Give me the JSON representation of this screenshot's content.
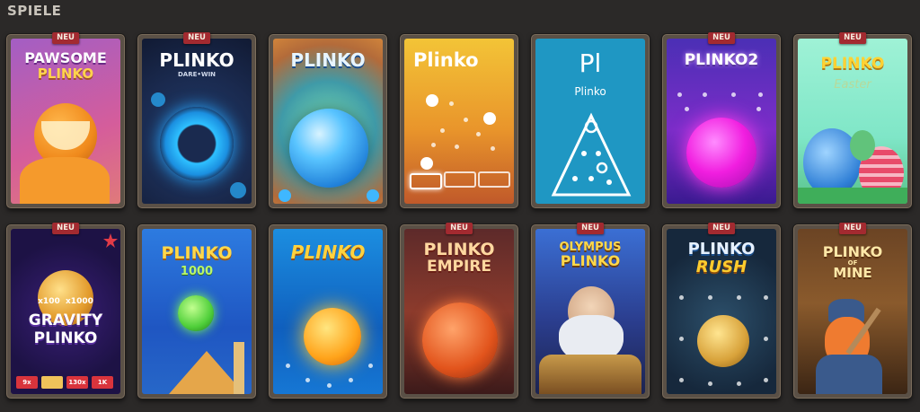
{
  "section": {
    "title": "SPIELE"
  },
  "badge_label": "NEU",
  "games": [
    {
      "logo": "PAWSOME",
      "logo2": "PLINKO",
      "badge": true
    },
    {
      "logo": "PLINKO",
      "sub": "DARE•WIN",
      "badge": true
    },
    {
      "logo": "PLINKO",
      "badge": false
    },
    {
      "logo": "Plinko",
      "badge": false
    },
    {
      "logo": "Pl",
      "sub": "Plinko",
      "badge": false
    },
    {
      "logo": "PLINKO2",
      "badge": true
    },
    {
      "logo": "PLINKO",
      "sub": "Easter",
      "badge": true
    },
    {
      "logo": "GRAVITY",
      "logo2": "PLINKO",
      "mult1": "x100",
      "mult2": "x1000",
      "chips": [
        "9x",
        "",
        "130x",
        "1K"
      ],
      "badge": true
    },
    {
      "logo": "PLINKO",
      "sub": "1000",
      "badge": false
    },
    {
      "logo": "PLINKO",
      "badge": false
    },
    {
      "logo": "PLINKO",
      "logo2": "EMPIRE",
      "badge": true
    },
    {
      "logo": "OLYMPUS",
      "logo2": "PLINKO",
      "badge": true
    },
    {
      "logo": "PLINKO",
      "logo2": "RUSH",
      "badge": true
    },
    {
      "logo": "PLINKO",
      "logo2": "MINE",
      "sub": "OF",
      "badge": true
    }
  ]
}
